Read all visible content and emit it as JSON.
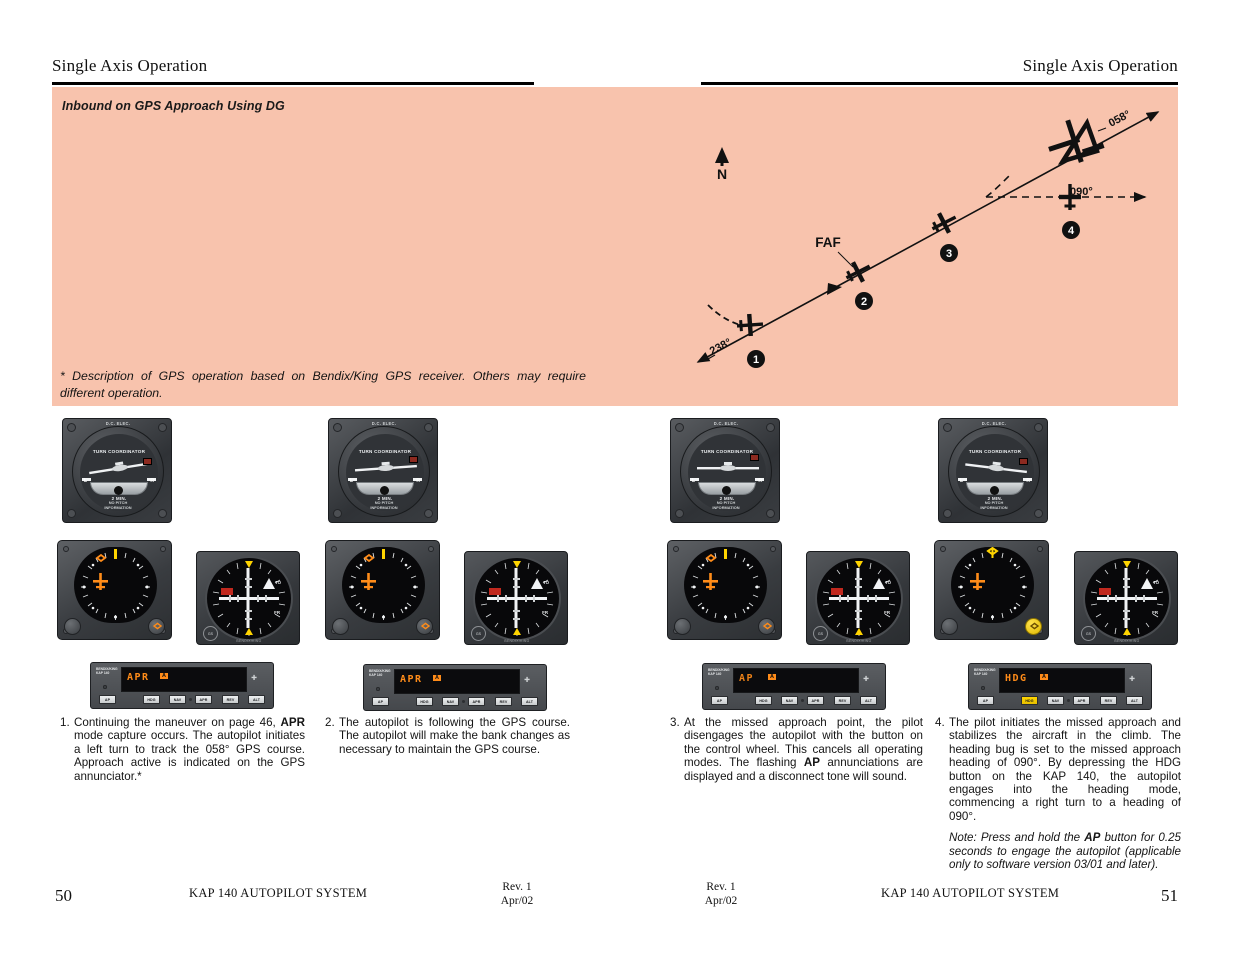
{
  "header": {
    "left_title": "Single Axis Operation",
    "right_title": "Single Axis Operation"
  },
  "band": {
    "title": "Inbound on GPS Approach Using DG",
    "footnote": "* Description of GPS operation based on Bendix/King GPS receiver. Others may require different operation."
  },
  "diagram": {
    "north_label": "N",
    "faf_label": "FAF",
    "inbound_course_label": "238°",
    "gps_course_label": "058°",
    "missed_approach_heading_label": "090°",
    "waypoints": [
      "1",
      "2",
      "3",
      "4"
    ]
  },
  "instruments": {
    "turn_coordinator": {
      "power_label": "D.C. ELEC.",
      "title": "TURN COORDINATOR",
      "left_mark": "L",
      "right_mark": "R",
      "rate_label": "2 MIN.",
      "no_pitch_line1": "NO PITCH",
      "no_pitch_line2": "INFORMATION"
    },
    "cdi": {
      "to_label": "TO",
      "from_label": "FR",
      "gs_label": "GS",
      "brand_label": "BENDIX/KING"
    },
    "kap140": {
      "brand_line1": "BENDIX/KING",
      "brand_line2": "KAP 140",
      "buttons": [
        "AP",
        "HDG",
        "NAV",
        "APR",
        "REV",
        "ALT"
      ]
    }
  },
  "panels": [
    {
      "id": 1,
      "display": "APR",
      "badge": "A",
      "active_button": null,
      "heading_bug": "bug-left"
    },
    {
      "id": 2,
      "display": "APR",
      "badge": "A",
      "active_button": null,
      "heading_bug": "bug-left"
    },
    {
      "id": 3,
      "display": "AP",
      "badge": "A",
      "active_button": null,
      "heading_bug": "bug-left",
      "flashing": true
    },
    {
      "id": 4,
      "display": "HDG",
      "badge": "A",
      "active_button": "HDG",
      "heading_bug": "bug-top"
    }
  ],
  "captions": [
    {
      "number": "1.",
      "segments": [
        {
          "text": "Continuing the maneuver on page 46, ",
          "bold": false
        },
        {
          "text": "APR",
          "bold": true
        },
        {
          "text": " mode capture occurs. The autopilot initiates a left turn to track the 058° GPS course. Approach active is indicated on the GPS annunciator.*",
          "bold": false
        }
      ]
    },
    {
      "number": "2.",
      "segments": [
        {
          "text": "The autopilot is following the GPS course. The autopilot will make the bank changes as necessary to maintain the GPS course.",
          "bold": false
        }
      ]
    },
    {
      "number": "3.",
      "segments": [
        {
          "text": "At the missed approach point, the pilot disengages the autopilot with the button on the control wheel. This cancels all operating modes. The flashing ",
          "bold": false
        },
        {
          "text": "AP",
          "bold": true
        },
        {
          "text": " annunciations are displayed and a disconnect tone will sound.",
          "bold": false
        }
      ]
    },
    {
      "number": "4.",
      "segments": [
        {
          "text": "The pilot initiates the missed approach and stabilizes the aircraft in the climb. The heading bug is set to the missed approach heading of 090°. By depressing the HDG button on the KAP 140, the autopilot engages into the heading mode, commencing a right turn to a heading of 090°.",
          "bold": false
        }
      ],
      "note_segments": [
        {
          "text": "Note: Press and hold the ",
          "bold": false,
          "italic": true
        },
        {
          "text": "AP",
          "bold": true,
          "italic": true
        },
        {
          "text": " button for 0.25 seconds to engage the autopilot (applicable only to software version 03/01 and later).",
          "bold": false,
          "italic": true
        }
      ]
    }
  ],
  "footer": {
    "left_page_number": "50",
    "left_title": "KAP 140 AUTOPILOT SYSTEM",
    "left_rev_line1": "Rev. 1",
    "left_rev_line2": "Apr/02",
    "right_rev_line1": "Rev. 1",
    "right_rev_line2": "Apr/02",
    "right_title": "KAP 140 AUTOPILOT SYSTEM",
    "right_page_number": "51"
  },
  "colors": {
    "band_background": "#f8c3ad",
    "page_background": "#ffffff",
    "segment_amber": "#ff8c19",
    "active_button_yellow": "#ffd400",
    "warning_red": "#c1281e"
  }
}
